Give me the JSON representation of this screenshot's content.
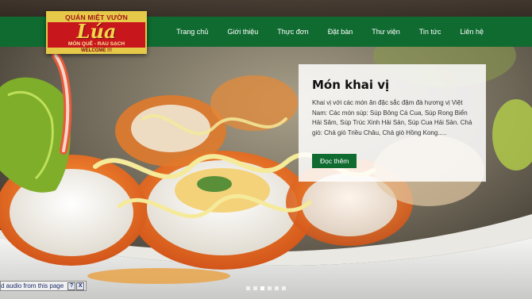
{
  "logo": {
    "top_text": "QUÁN MIỆT VƯỜN",
    "main_text": "Lúa",
    "sub_text": "MÓN QUÊ - RAU SẠCH",
    "welcome_text": "WELCOME !!!"
  },
  "nav": {
    "items": [
      "Trang chủ",
      "Giới thiệu",
      "Thực đơn",
      "Đặt bàn",
      "Thư viện",
      "Tin tức",
      "Liên hệ"
    ]
  },
  "card": {
    "title": "Món khai vị",
    "description": "Khai vị với các món ăn đặc sắc đậm đà hương vị Việt Nam: Các món súp: Súp Bông Cá Cua, Súp Rong Biển Hải Sâm, Súp Trúc Xinh Hải Sản, Súp Cua Hải Sản. Chả giò: Chả giò Triều Châu, Chả giò Hồng Kong.....",
    "button_label": "Đọc thêm"
  },
  "slider": {
    "total": 6,
    "active_index": 2
  },
  "plugin_bar": {
    "text": "d audio from this page",
    "help_label": "?",
    "close_label": "X"
  },
  "colors": {
    "nav_green": "#0f6b30",
    "logo_red": "#c8161d",
    "logo_gold": "#e7c94a"
  }
}
